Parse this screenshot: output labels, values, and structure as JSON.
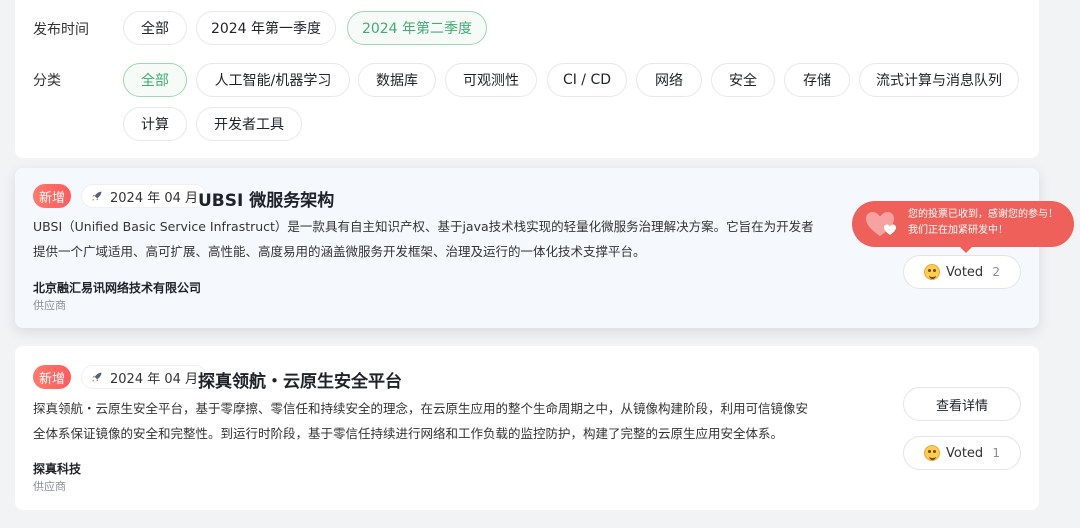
{
  "filters": {
    "publish_time": {
      "label": "发布时间",
      "options": [
        "全部",
        "2024 年第一季度",
        "2024 年第二季度"
      ],
      "selected": "2024 年第二季度"
    },
    "category": {
      "label": "分类",
      "options": [
        "全部",
        "人工智能/机器学习",
        "数据库",
        "可观测性",
        "CI / CD",
        "网络",
        "安全",
        "存储",
        "流式计算与消息队列",
        "计算",
        "开发者工具"
      ],
      "selected": "全部"
    }
  },
  "cards": [
    {
      "badge": "新增",
      "date": "2024 年 04 月",
      "title": "UBSI 微服务架构",
      "description": "UBSI（Unified Basic Service Infrastruct）是一款具有自主知识产权、基于java技术栈实现的轻量化微服务治理解决方案。它旨在为开发者提供一个广域适用、高可扩展、高性能、高度易用的涵盖微服务开发框架、治理及运行的一体化技术支撑平台。",
      "company": "北京融汇易讯网络技术有限公司",
      "role": "供应商",
      "vote_label": "Voted",
      "vote_count": "2"
    },
    {
      "badge": "新增",
      "date": "2024 年 04 月",
      "title": "探真领航・云原生安全平台",
      "description": "探真领航・云原生安全平台，基于零摩擦、零信任和持续安全的理念，在云原生应用的整个生命周期之中，从镜像构建阶段，利用可信镜像安全体系保证镜像的安全和完整性。到运行时阶段，基于零信任持续进行网络和工作负载的监控防护，构建了完整的云原生应用安全体系。",
      "company": "探真科技",
      "role": "供应商",
      "detail_label": "查看详情",
      "vote_label": "Voted",
      "vote_count": "1"
    }
  ],
  "toast": {
    "line1": "您的投票已收到，感谢您的参与！",
    "line2": "我们正在加紧研发中！"
  },
  "colors": {
    "accent_green": "#3fae72",
    "badge_red": "#ff5a5f",
    "toast_bg": "#f0605a"
  }
}
